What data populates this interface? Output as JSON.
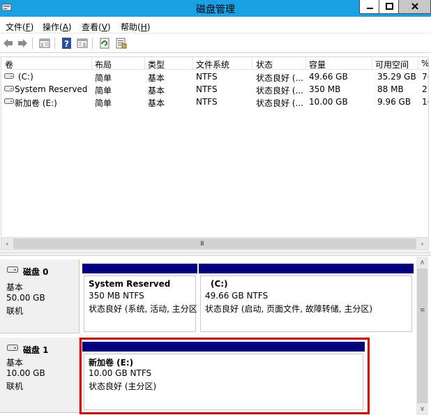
{
  "window": {
    "title": "磁盘管理",
    "app_icon": "disk-management-icon",
    "minimize_icon": "minimize-icon",
    "maximize_icon": "maximize-icon",
    "close_icon": "close-icon"
  },
  "menu": [
    {
      "label": "文件",
      "accel": "F"
    },
    {
      "label": "操作",
      "accel": "A"
    },
    {
      "label": "查看",
      "accel": "V"
    },
    {
      "label": "帮助",
      "accel": "H"
    }
  ],
  "toolbar": {
    "buttons": [
      "back-arrow-icon",
      "forward-arrow-icon",
      "console-tree-icon",
      "help-icon",
      "properties-icon",
      "refresh-icon",
      "export-list-icon"
    ]
  },
  "volume_list": {
    "columns": [
      "卷",
      "布局",
      "类型",
      "文件系统",
      "状态",
      "容量",
      "可用空间",
      "%"
    ],
    "rows": [
      {
        "volume": "(C:)",
        "layout": "简单",
        "type": "基本",
        "fs": "NTFS",
        "status": "状态良好 (...",
        "capacity": "49.66 GB",
        "free": "35.29 GB",
        "pct": "7("
      },
      {
        "volume": "System Reserved",
        "layout": "简单",
        "type": "基本",
        "fs": "NTFS",
        "status": "状态良好 (...",
        "capacity": "350 MB",
        "free": "88 MB",
        "pct": "2!"
      },
      {
        "volume": "新加卷 (E:)",
        "layout": "简单",
        "type": "基本",
        "fs": "NTFS",
        "status": "状态良好 (...",
        "capacity": "10.00 GB",
        "free": "9.96 GB",
        "pct": "1("
      }
    ],
    "hscroll_grip": "III"
  },
  "disks": [
    {
      "name": "磁盘 0",
      "type": "基本",
      "size": "50.00 GB",
      "state": "联机",
      "partitions": [
        {
          "name": "System Reserved",
          "size_fs": "350 MB NTFS",
          "status": "状态良好 (系统, 活动, 主分区"
        },
        {
          "name": "(C:)",
          "size_fs": "49.66 GB NTFS",
          "status": "状态良好 (启动, 页面文件, 故障转储, 主分区)"
        }
      ]
    },
    {
      "name": "磁盘 1",
      "type": "基本",
      "size": "10.00 GB",
      "state": "联机",
      "partitions": [
        {
          "name": "新加卷 (E:)",
          "size_fs": "10.00 GB NTFS",
          "status": "状态良好 (主分区)"
        }
      ]
    }
  ],
  "colors": {
    "titlebar": "#1aa1e3",
    "partition_bar": "#000080",
    "highlight": "#e00000"
  }
}
